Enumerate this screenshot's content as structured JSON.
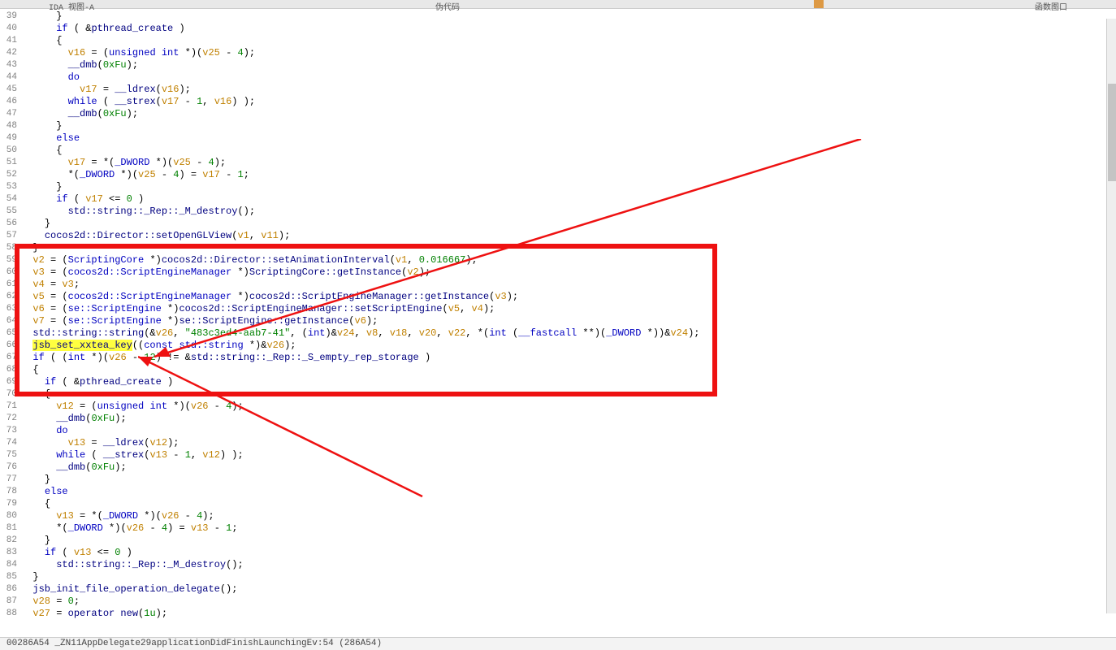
{
  "top": {
    "tab1": "IDA 视图-A",
    "tab2": "伪代码",
    "tab3": "函数图口"
  },
  "lines": [
    {
      "n": 39,
      "i": 2,
      "seg": [
        {
          "t": "}"
        }
      ]
    },
    {
      "n": 40,
      "i": 2,
      "seg": [
        {
          "c": "kw",
          "t": "if"
        },
        {
          "t": " ( &"
        },
        {
          "c": "fn",
          "t": "pthread_create"
        },
        {
          "t": " )"
        }
      ]
    },
    {
      "n": 41,
      "i": 2,
      "seg": [
        {
          "t": "{"
        }
      ]
    },
    {
      "n": 42,
      "i": 3,
      "seg": [
        {
          "c": "var",
          "t": "v16"
        },
        {
          "t": " = ("
        },
        {
          "c": "ty",
          "t": "unsigned int"
        },
        {
          "t": " *)("
        },
        {
          "c": "var",
          "t": "v25"
        },
        {
          "t": " - "
        },
        {
          "c": "num",
          "t": "4"
        },
        {
          "t": ");"
        }
      ]
    },
    {
      "n": 43,
      "i": 3,
      "seg": [
        {
          "c": "fn",
          "t": "__dmb"
        },
        {
          "t": "("
        },
        {
          "c": "num",
          "t": "0xFu"
        },
        {
          "t": ");"
        }
      ]
    },
    {
      "n": 44,
      "i": 3,
      "seg": [
        {
          "c": "kw",
          "t": "do"
        }
      ]
    },
    {
      "n": 45,
      "i": 4,
      "seg": [
        {
          "c": "var",
          "t": "v17"
        },
        {
          "t": " = "
        },
        {
          "c": "fn",
          "t": "__ldrex"
        },
        {
          "t": "("
        },
        {
          "c": "var",
          "t": "v16"
        },
        {
          "t": ");"
        }
      ]
    },
    {
      "n": 46,
      "i": 3,
      "seg": [
        {
          "c": "kw",
          "t": "while"
        },
        {
          "t": " ( "
        },
        {
          "c": "fn",
          "t": "__strex"
        },
        {
          "t": "("
        },
        {
          "c": "var",
          "t": "v17"
        },
        {
          "t": " - "
        },
        {
          "c": "num",
          "t": "1"
        },
        {
          "t": ", "
        },
        {
          "c": "var",
          "t": "v16"
        },
        {
          "t": ") );"
        }
      ]
    },
    {
      "n": 47,
      "i": 3,
      "seg": [
        {
          "c": "fn",
          "t": "__dmb"
        },
        {
          "t": "("
        },
        {
          "c": "num",
          "t": "0xFu"
        },
        {
          "t": ");"
        }
      ]
    },
    {
      "n": 48,
      "i": 2,
      "seg": [
        {
          "t": "}"
        }
      ]
    },
    {
      "n": 49,
      "i": 2,
      "seg": [
        {
          "c": "kw",
          "t": "else"
        }
      ]
    },
    {
      "n": 50,
      "i": 2,
      "seg": [
        {
          "t": "{"
        }
      ]
    },
    {
      "n": 51,
      "i": 3,
      "seg": [
        {
          "c": "var",
          "t": "v17"
        },
        {
          "t": " = *("
        },
        {
          "c": "ty",
          "t": "_DWORD"
        },
        {
          "t": " *)("
        },
        {
          "c": "var",
          "t": "v25"
        },
        {
          "t": " - "
        },
        {
          "c": "num",
          "t": "4"
        },
        {
          "t": ");"
        }
      ]
    },
    {
      "n": 52,
      "i": 3,
      "seg": [
        {
          "t": "*("
        },
        {
          "c": "ty",
          "t": "_DWORD"
        },
        {
          "t": " *)("
        },
        {
          "c": "var",
          "t": "v25"
        },
        {
          "t": " - "
        },
        {
          "c": "num",
          "t": "4"
        },
        {
          "t": ") = "
        },
        {
          "c": "var",
          "t": "v17"
        },
        {
          "t": " - "
        },
        {
          "c": "num",
          "t": "1"
        },
        {
          "t": ";"
        }
      ]
    },
    {
      "n": 53,
      "i": 2,
      "seg": [
        {
          "t": "}"
        }
      ]
    },
    {
      "n": 54,
      "i": 2,
      "seg": [
        {
          "c": "kw",
          "t": "if"
        },
        {
          "t": " ( "
        },
        {
          "c": "var",
          "t": "v17"
        },
        {
          "t": " <= "
        },
        {
          "c": "num",
          "t": "0"
        },
        {
          "t": " )"
        }
      ]
    },
    {
      "n": 55,
      "i": 3,
      "seg": [
        {
          "c": "fn",
          "t": "std::string::_Rep::_M_destroy"
        },
        {
          "t": "();"
        }
      ]
    },
    {
      "n": 56,
      "i": 1,
      "seg": [
        {
          "t": "}"
        }
      ]
    },
    {
      "n": 57,
      "i": 1,
      "seg": [
        {
          "c": "fn",
          "t": "cocos2d::Director::setOpenGLView"
        },
        {
          "t": "("
        },
        {
          "c": "var",
          "t": "v1"
        },
        {
          "t": ", "
        },
        {
          "c": "var",
          "t": "v11"
        },
        {
          "t": ");"
        }
      ]
    },
    {
      "n": 58,
      "i": 0,
      "seg": [
        {
          "t": "}"
        }
      ]
    },
    {
      "n": 59,
      "i": 0,
      "seg": [
        {
          "c": "var",
          "t": "v2"
        },
        {
          "t": " = ("
        },
        {
          "c": "ty",
          "t": "ScriptingCore"
        },
        {
          "t": " *)"
        },
        {
          "c": "fn",
          "t": "cocos2d::Director::setAnimationInterval"
        },
        {
          "t": "("
        },
        {
          "c": "var",
          "t": "v1"
        },
        {
          "t": ", "
        },
        {
          "c": "num",
          "t": "0.016667"
        },
        {
          "t": ");"
        }
      ]
    },
    {
      "n": 60,
      "i": 0,
      "seg": [
        {
          "c": "var",
          "t": "v3"
        },
        {
          "t": " = ("
        },
        {
          "c": "ty",
          "t": "cocos2d::ScriptEngineManager"
        },
        {
          "t": " *)"
        },
        {
          "c": "fn",
          "t": "ScriptingCore::getInstance"
        },
        {
          "t": "("
        },
        {
          "c": "var",
          "t": "v2"
        },
        {
          "t": ");"
        }
      ]
    },
    {
      "n": 61,
      "i": 0,
      "seg": [
        {
          "c": "var",
          "t": "v4"
        },
        {
          "t": " = "
        },
        {
          "c": "var",
          "t": "v3"
        },
        {
          "t": ";"
        }
      ]
    },
    {
      "n": 62,
      "i": 0,
      "seg": [
        {
          "c": "var",
          "t": "v5"
        },
        {
          "t": " = ("
        },
        {
          "c": "ty",
          "t": "cocos2d::ScriptEngineManager"
        },
        {
          "t": " *)"
        },
        {
          "c": "fn",
          "t": "cocos2d::ScriptEngineManager::getInstance"
        },
        {
          "t": "("
        },
        {
          "c": "var",
          "t": "v3"
        },
        {
          "t": ");"
        }
      ]
    },
    {
      "n": 63,
      "i": 0,
      "seg": [
        {
          "c": "var",
          "t": "v6"
        },
        {
          "t": " = ("
        },
        {
          "c": "ty",
          "t": "se::ScriptEngine"
        },
        {
          "t": " *)"
        },
        {
          "c": "fn",
          "t": "cocos2d::ScriptEngineManager::setScriptEngine"
        },
        {
          "t": "("
        },
        {
          "c": "var",
          "t": "v5"
        },
        {
          "t": ", "
        },
        {
          "c": "var",
          "t": "v4"
        },
        {
          "t": ");"
        }
      ]
    },
    {
      "n": 64,
      "i": 0,
      "seg": [
        {
          "c": "var",
          "t": "v7"
        },
        {
          "t": " = ("
        },
        {
          "c": "ty",
          "t": "se::ScriptEngine"
        },
        {
          "t": " *)"
        },
        {
          "c": "fn",
          "t": "se::ScriptEngine::getInstance"
        },
        {
          "t": "("
        },
        {
          "c": "var",
          "t": "v6"
        },
        {
          "t": ");"
        }
      ]
    },
    {
      "n": 65,
      "i": 0,
      "seg": [
        {
          "c": "fn",
          "t": "std::string::string"
        },
        {
          "t": "(&"
        },
        {
          "c": "var",
          "t": "v26"
        },
        {
          "t": ", "
        },
        {
          "c": "str",
          "t": "\"483c3ed4-aab7-41\""
        },
        {
          "t": ", ("
        },
        {
          "c": "ty",
          "t": "int"
        },
        {
          "t": ")&"
        },
        {
          "c": "var",
          "t": "v24"
        },
        {
          "t": ", "
        },
        {
          "c": "var",
          "t": "v8"
        },
        {
          "t": ", "
        },
        {
          "c": "var",
          "t": "v18"
        },
        {
          "t": ", "
        },
        {
          "c": "var",
          "t": "v20"
        },
        {
          "t": ", "
        },
        {
          "c": "var",
          "t": "v22"
        },
        {
          "t": ", *("
        },
        {
          "c": "ty",
          "t": "int"
        },
        {
          "t": " ("
        },
        {
          "c": "ty",
          "t": "__fastcall"
        },
        {
          "t": " **)("
        },
        {
          "c": "ty",
          "t": "_DWORD"
        },
        {
          "t": " *))&"
        },
        {
          "c": "var",
          "t": "v24"
        },
        {
          "t": ");"
        }
      ]
    },
    {
      "n": 66,
      "i": 0,
      "seg": [
        {
          "c": "fn hl",
          "t": "jsb_set_xxtea_key"
        },
        {
          "t": "(("
        },
        {
          "c": "ty",
          "t": "const std::string"
        },
        {
          "t": " *)&"
        },
        {
          "c": "var",
          "t": "v26"
        },
        {
          "t": ");"
        }
      ]
    },
    {
      "n": 67,
      "i": 0,
      "seg": [
        {
          "c": "kw",
          "t": "if"
        },
        {
          "t": " ( ("
        },
        {
          "c": "ty",
          "t": "int"
        },
        {
          "t": " *)("
        },
        {
          "c": "var",
          "t": "v26"
        },
        {
          "t": " - "
        },
        {
          "c": "num",
          "t": "12"
        },
        {
          "t": ") != &"
        },
        {
          "c": "fn",
          "t": "std::string::_Rep::_S_empty_rep_storage"
        },
        {
          "t": " )"
        }
      ]
    },
    {
      "n": 68,
      "i": 0,
      "seg": [
        {
          "t": "{"
        }
      ]
    },
    {
      "n": 69,
      "i": 1,
      "seg": [
        {
          "c": "kw",
          "t": "if"
        },
        {
          "t": " ( &"
        },
        {
          "c": "fn",
          "t": "pthread_create"
        },
        {
          "t": " )"
        }
      ]
    },
    {
      "n": 70,
      "i": 1,
      "seg": [
        {
          "t": "{"
        }
      ]
    },
    {
      "n": 71,
      "i": 2,
      "seg": [
        {
          "c": "var",
          "t": "v12"
        },
        {
          "t": " = ("
        },
        {
          "c": "ty",
          "t": "unsigned int"
        },
        {
          "t": " *)("
        },
        {
          "c": "var",
          "t": "v26"
        },
        {
          "t": " - "
        },
        {
          "c": "num",
          "t": "4"
        },
        {
          "t": ");"
        }
      ]
    },
    {
      "n": 72,
      "i": 2,
      "seg": [
        {
          "c": "fn",
          "t": "__dmb"
        },
        {
          "t": "("
        },
        {
          "c": "num",
          "t": "0xFu"
        },
        {
          "t": ");"
        }
      ]
    },
    {
      "n": 73,
      "i": 2,
      "seg": [
        {
          "c": "kw",
          "t": "do"
        }
      ]
    },
    {
      "n": 74,
      "i": 3,
      "seg": [
        {
          "c": "var",
          "t": "v13"
        },
        {
          "t": " = "
        },
        {
          "c": "fn",
          "t": "__ldrex"
        },
        {
          "t": "("
        },
        {
          "c": "var",
          "t": "v12"
        },
        {
          "t": ");"
        }
      ]
    },
    {
      "n": 75,
      "i": 2,
      "seg": [
        {
          "c": "kw",
          "t": "while"
        },
        {
          "t": " ( "
        },
        {
          "c": "fn",
          "t": "__strex"
        },
        {
          "t": "("
        },
        {
          "c": "var",
          "t": "v13"
        },
        {
          "t": " - "
        },
        {
          "c": "num",
          "t": "1"
        },
        {
          "t": ", "
        },
        {
          "c": "var",
          "t": "v12"
        },
        {
          "t": ") );"
        }
      ]
    },
    {
      "n": 76,
      "i": 2,
      "seg": [
        {
          "c": "fn",
          "t": "__dmb"
        },
        {
          "t": "("
        },
        {
          "c": "num",
          "t": "0xFu"
        },
        {
          "t": ");"
        }
      ]
    },
    {
      "n": 77,
      "i": 1,
      "seg": [
        {
          "t": "}"
        }
      ]
    },
    {
      "n": 78,
      "i": 1,
      "seg": [
        {
          "c": "kw",
          "t": "else"
        }
      ]
    },
    {
      "n": 79,
      "i": 1,
      "seg": [
        {
          "t": "{"
        }
      ]
    },
    {
      "n": 80,
      "i": 2,
      "seg": [
        {
          "c": "var",
          "t": "v13"
        },
        {
          "t": " = *("
        },
        {
          "c": "ty",
          "t": "_DWORD"
        },
        {
          "t": " *)("
        },
        {
          "c": "var",
          "t": "v26"
        },
        {
          "t": " - "
        },
        {
          "c": "num",
          "t": "4"
        },
        {
          "t": ");"
        }
      ]
    },
    {
      "n": 81,
      "i": 2,
      "seg": [
        {
          "t": "*("
        },
        {
          "c": "ty",
          "t": "_DWORD"
        },
        {
          "t": " *)("
        },
        {
          "c": "var",
          "t": "v26"
        },
        {
          "t": " - "
        },
        {
          "c": "num",
          "t": "4"
        },
        {
          "t": ") = "
        },
        {
          "c": "var",
          "t": "v13"
        },
        {
          "t": " - "
        },
        {
          "c": "num",
          "t": "1"
        },
        {
          "t": ";"
        }
      ]
    },
    {
      "n": 82,
      "i": 1,
      "seg": [
        {
          "t": "}"
        }
      ]
    },
    {
      "n": 83,
      "i": 1,
      "seg": [
        {
          "c": "kw",
          "t": "if"
        },
        {
          "t": " ( "
        },
        {
          "c": "var",
          "t": "v13"
        },
        {
          "t": " <= "
        },
        {
          "c": "num",
          "t": "0"
        },
        {
          "t": " )"
        }
      ]
    },
    {
      "n": 84,
      "i": 2,
      "seg": [
        {
          "c": "fn",
          "t": "std::string::_Rep::_M_destroy"
        },
        {
          "t": "();"
        }
      ]
    },
    {
      "n": 85,
      "i": 0,
      "seg": [
        {
          "t": "}"
        }
      ]
    },
    {
      "n": 86,
      "i": 0,
      "seg": [
        {
          "c": "fn",
          "t": "jsb_init_file_operation_delegate"
        },
        {
          "t": "();"
        }
      ]
    },
    {
      "n": 87,
      "i": 0,
      "seg": [
        {
          "c": "var",
          "t": "v28"
        },
        {
          "t": " = "
        },
        {
          "c": "num",
          "t": "0"
        },
        {
          "t": ";"
        }
      ]
    },
    {
      "n": 88,
      "i": 0,
      "seg": [
        {
          "c": "var",
          "t": "v27"
        },
        {
          "t": " = "
        },
        {
          "c": "fn",
          "t": "operator new"
        },
        {
          "t": "("
        },
        {
          "c": "num",
          "t": "1u"
        },
        {
          "t": ");"
        }
      ]
    }
  ],
  "status": "00286A54 _ZN11AppDelegate29applicationDidFinishLaunchingEv:54 (286A54)"
}
